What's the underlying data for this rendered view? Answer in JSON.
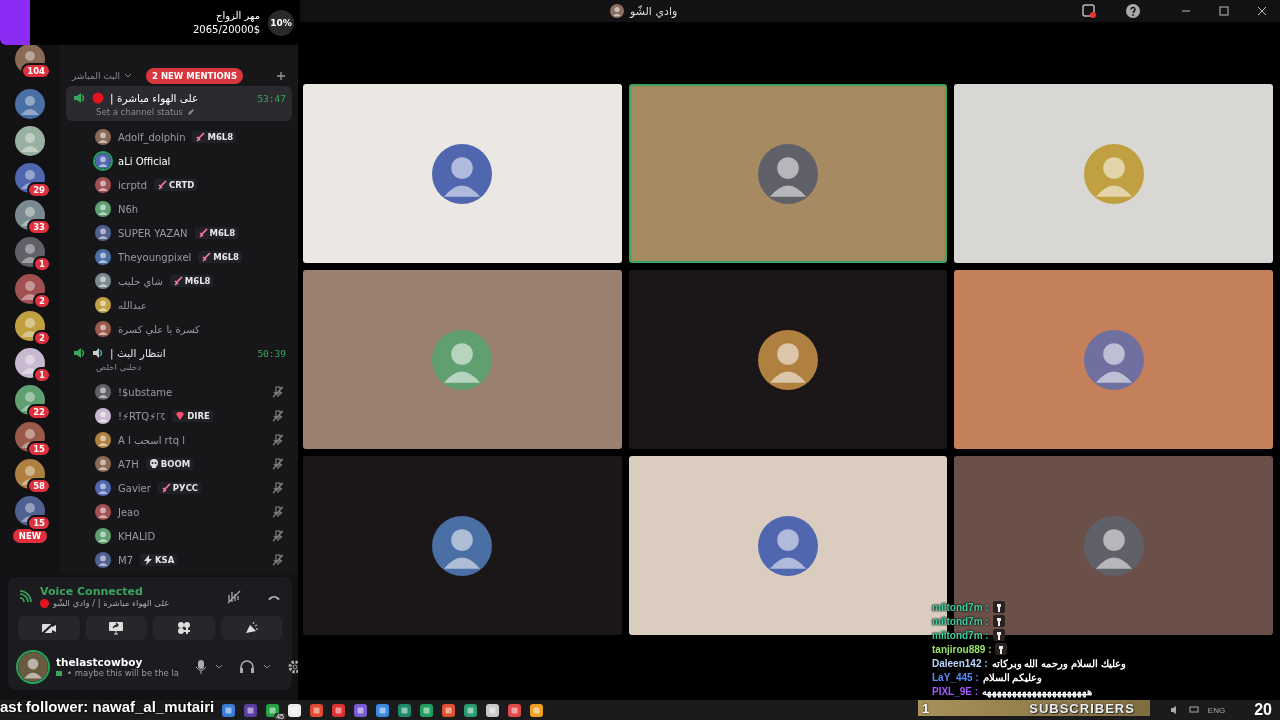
{
  "window": {
    "title": "وادي الشّو"
  },
  "stream_overlay": {
    "goal_title": "مهر الزواج",
    "goal_amount": "2065/20000$",
    "goal_percent": "10%",
    "level": 0.1
  },
  "servers": [
    {
      "kind": "server",
      "badge": "104"
    },
    {
      "kind": "server"
    },
    {
      "kind": "server"
    },
    {
      "kind": "server",
      "badge": "29"
    },
    {
      "kind": "server",
      "badge": "33"
    },
    {
      "kind": "server",
      "badge": "1"
    },
    {
      "kind": "server",
      "badge": "2"
    },
    {
      "kind": "server",
      "badge": "2"
    },
    {
      "kind": "server",
      "badge": "1"
    },
    {
      "kind": "server",
      "badge": "22"
    },
    {
      "kind": "server",
      "badge": "15"
    },
    {
      "kind": "server",
      "badge": "58"
    },
    {
      "kind": "server",
      "badge": "15"
    },
    {
      "kind": "new",
      "label": "NEW"
    }
  ],
  "category": {
    "name": "البث المباشر",
    "expanded": true,
    "mentions": "2 NEW MENTIONS"
  },
  "voice_channels": [
    {
      "name": "على الهواء مباشرة |",
      "live": true,
      "selected": true,
      "timer": "53:47",
      "status": "Set a channel status",
      "members": [
        {
          "name": "Adolf_dolphin",
          "tag": {
            "kind": "sword",
            "label": "M6L8"
          },
          "speaking": false,
          "muted": false
        },
        {
          "name": "aLi Official",
          "speaking": true,
          "muted": false
        },
        {
          "name": "icrptd",
          "tag": {
            "kind": "sword",
            "label": "CRTD"
          },
          "speaking": false,
          "muted": false
        },
        {
          "name": "N6h",
          "speaking": false,
          "muted": false
        },
        {
          "name": "SUPER YAZAN",
          "tag": {
            "kind": "sword",
            "label": "M6L8"
          },
          "speaking": false,
          "muted": false
        },
        {
          "name": "Theyoungpixel",
          "tag": {
            "kind": "sword",
            "label": "M6L8"
          },
          "speaking": false,
          "muted": false
        },
        {
          "name": "شاي حليب",
          "tag": {
            "kind": "sword",
            "label": "M6L8"
          },
          "speaking": false,
          "muted": false
        },
        {
          "name": "عبدالله",
          "speaking": false,
          "muted": false
        },
        {
          "name": "كسرة يا علي كسرة",
          "speaking": false,
          "muted": false
        }
      ]
    },
    {
      "name": "انتظار البث |",
      "live": false,
      "selected": false,
      "timer": "50:39",
      "status": "دخلني اخلص",
      "members": [
        {
          "name": "!$ubstame",
          "speaking": false,
          "muted": true
        },
        {
          "name": "!⚡RTQ⚡☈",
          "tag": {
            "kind": "gem",
            "label": "DIRE"
          },
          "speaking": false,
          "muted": true
        },
        {
          "name": "A l اسحب rtq l",
          "speaking": false,
          "muted": true
        },
        {
          "name": "A7H",
          "tag": {
            "kind": "skull",
            "label": "BOOM"
          },
          "speaking": false,
          "muted": true
        },
        {
          "name": "Gavier",
          "tag": {
            "kind": "sword",
            "label": "РУСС"
          },
          "speaking": false,
          "muted": true
        },
        {
          "name": "Jeao",
          "speaking": false,
          "muted": true
        },
        {
          "name": "KHALID",
          "speaking": false,
          "muted": true
        },
        {
          "name": "M7",
          "tag": {
            "kind": "bolt",
            "label": "KSA"
          },
          "speaking": false,
          "muted": true
        }
      ]
    }
  ],
  "voice_status": {
    "title": "Voice Connected",
    "location": "على الهواء مباشرة | / وادي الشّو"
  },
  "user": {
    "name": "thelastcowboy",
    "status": "• maybe this will be the la",
    "speaking": true
  },
  "tiles": [
    {
      "color": "#ebe8e4",
      "speaking": false
    },
    {
      "color": "#a58a62",
      "speaking": true
    },
    {
      "color": "#d8d7d4",
      "speaking": false
    },
    {
      "color": "#9a8070",
      "speaking": false
    },
    {
      "color": "#1b1718",
      "speaking": false
    },
    {
      "color": "#c4805a",
      "speaking": false
    },
    {
      "color": "#1b1718",
      "speaking": false
    },
    {
      "color": "#dacdbf",
      "speaking": false
    },
    {
      "color": "#6a5048",
      "speaking": false
    }
  ],
  "chat": [
    {
      "user": "miltond7m :",
      "color": "#3fcf9f",
      "kind": "emote"
    },
    {
      "user": "miltond7m :",
      "color": "#3fcf9f",
      "kind": "emote"
    },
    {
      "user": "miltond7m :",
      "color": "#3fcf9f",
      "kind": "emote"
    },
    {
      "user": "tanjirou889 :",
      "color": "#9be36a",
      "kind": "emote"
    },
    {
      "user": "Daleen142 :",
      "color": "#b9d5ff",
      "kind": "text",
      "text": "وعليك السلام ورحمه الله وبركاته"
    },
    {
      "user": "LaY_445 :",
      "color": "#5a8cff",
      "kind": "text",
      "text": "وعليكم السلام"
    },
    {
      "user": "PIXL_9E :",
      "color": "#a15bff",
      "kind": "text",
      "text": "هههههههههههههههههههههه"
    }
  ],
  "subscribers_banner": {
    "count": "1",
    "label": "SUBSCRIBERS"
  },
  "clock_badge": "20",
  "ticker": "ast follower: nawaf_al_mutairi",
  "taskbar": {
    "app_badge": "45",
    "language": "ENG"
  }
}
